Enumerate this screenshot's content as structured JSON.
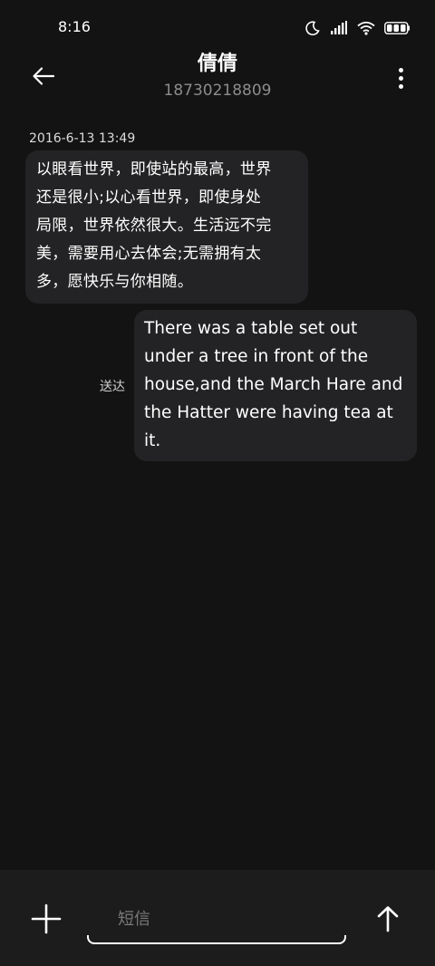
{
  "status_bar": {
    "time": "8:16",
    "icons": [
      "moon-icon",
      "signal-icon",
      "wifi-icon",
      "battery-icon"
    ]
  },
  "header": {
    "back_icon": "arrow-left-icon",
    "contact_name": "倩倩",
    "contact_number": "18730218809",
    "more_icon": "more-vertical-icon"
  },
  "conversation": {
    "timestamp": "2016-6-13 13:49",
    "received_message": {
      "lines": [
        "以眼看世界，即使站的最高，世界",
        "还是很小;以心看世界，即使身处",
        "局限，世界依然很大。生活远不完",
        "美，需要用心去体会;无需拥有太",
        "多，愿快乐与你相随。"
      ]
    },
    "sent_message": {
      "lines": [
        "There was a table set out",
        "under a tree in front of the",
        "house,and the March Hare and",
        "the Hatter were having tea at",
        "it."
      ],
      "status": "送达"
    }
  },
  "composer": {
    "add_icon": "plus-icon",
    "placeholder": "短信",
    "value": "",
    "send_icon": "arrow-up-icon"
  },
  "colors": {
    "background": "#131313",
    "bubble": "#232325",
    "composer_bar": "#1c1c1c",
    "secondary_text": "#8c8c8c"
  }
}
